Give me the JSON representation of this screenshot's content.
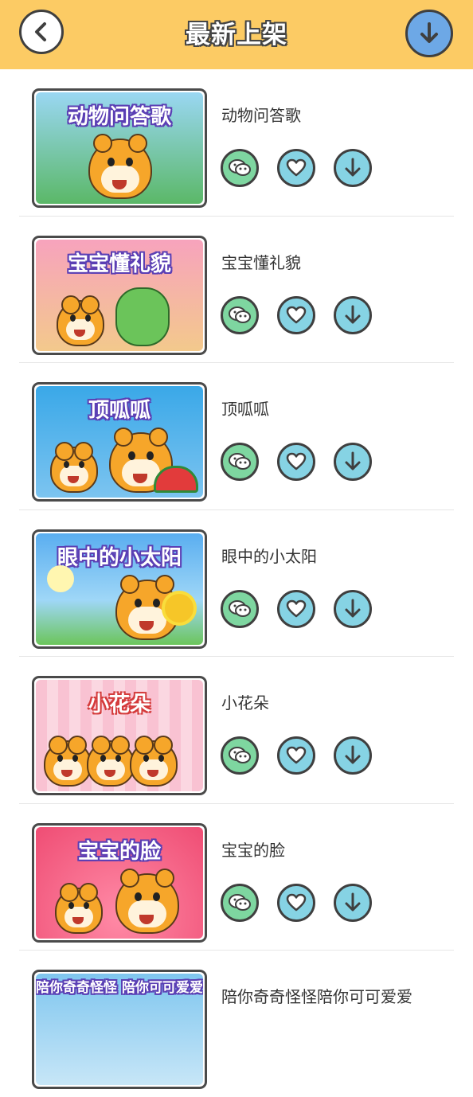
{
  "header": {
    "title": "最新上架",
    "back_icon": "back-arrow-icon",
    "download_icon": "download-icon",
    "bg_color": "#FCCB64"
  },
  "songs": [
    {
      "title": "动物问答歌",
      "thumb_title": "动物问答歌",
      "thumb_bg": "#8fd0f0"
    },
    {
      "title": "宝宝懂礼貌",
      "thumb_title": "宝宝懂礼貌",
      "thumb_bg": "#f7a7c0"
    },
    {
      "title": "顶呱呱",
      "thumb_title": "顶呱呱",
      "thumb_bg": "#4fb3ea"
    },
    {
      "title": "眼中的小太阳",
      "thumb_title": "眼中的小太阳",
      "thumb_bg": "#6ab8ef"
    },
    {
      "title": "小花朵",
      "thumb_title": "小花朵",
      "thumb_bg": "#f9c7d4"
    },
    {
      "title": "宝宝的脸",
      "thumb_title": "宝宝的脸",
      "thumb_bg": "#f2557c"
    },
    {
      "title": "陪你奇奇怪怪陪你可可爱爱",
      "thumb_title": "陪你奇奇怪怪 陪你可可爱爱",
      "thumb_bg": "#7fc6ef"
    }
  ],
  "icons": {
    "share": "wechat-icon",
    "favorite": "heart-icon",
    "download": "download-arrow-icon"
  }
}
